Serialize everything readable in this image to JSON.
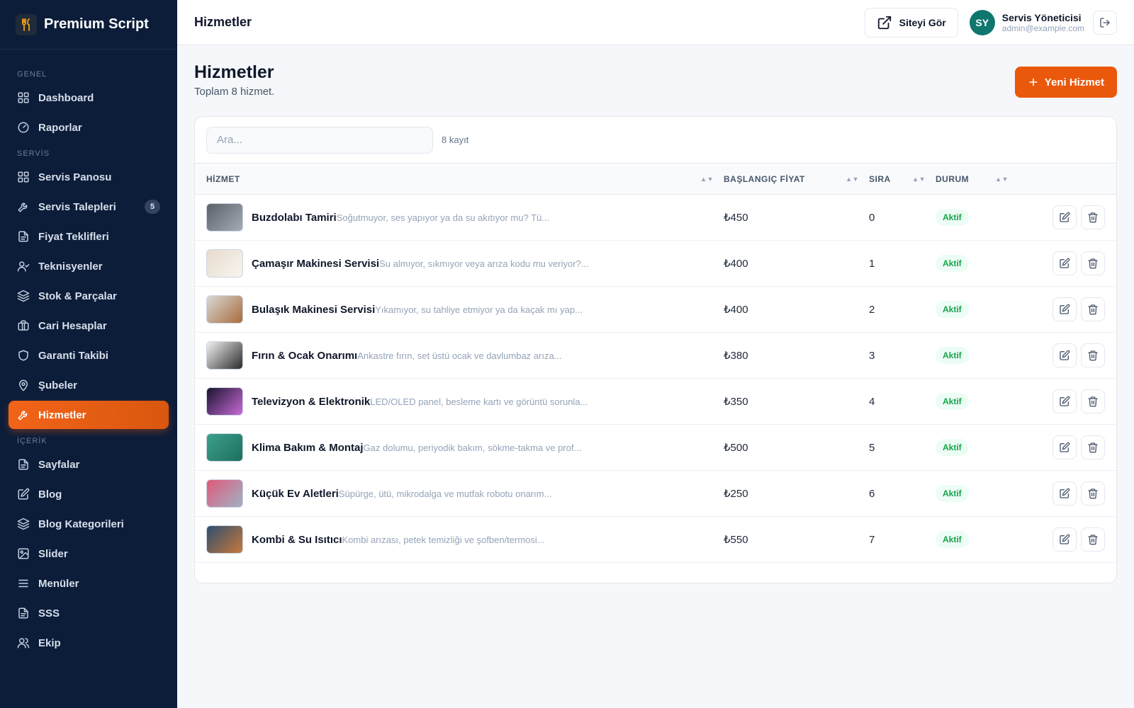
{
  "brand": {
    "title": "Premium Script"
  },
  "sidebar": {
    "sections": [
      {
        "label": "GENEL",
        "items": [
          {
            "label": "Dashboard",
            "icon": "grid-icon"
          },
          {
            "label": "Raporlar",
            "icon": "gauge-icon"
          }
        ]
      },
      {
        "label": "SERVİS",
        "items": [
          {
            "label": "Servis Panosu",
            "icon": "grid-icon"
          },
          {
            "label": "Servis Talepleri",
            "icon": "wrench-icon",
            "badge": "5"
          },
          {
            "label": "Fiyat Teklifleri",
            "icon": "document-icon"
          },
          {
            "label": "Teknisyenler",
            "icon": "user-check-icon"
          },
          {
            "label": "Stok & Parçalar",
            "icon": "layers-icon"
          },
          {
            "label": "Cari Hesaplar",
            "icon": "briefcase-icon"
          },
          {
            "label": "Garanti Takibi",
            "icon": "shield-icon"
          },
          {
            "label": "Şubeler",
            "icon": "map-pin-icon"
          },
          {
            "label": "Hizmetler",
            "icon": "wrench-icon",
            "active": true
          }
        ]
      },
      {
        "label": "İÇERİK",
        "items": [
          {
            "label": "Sayfalar",
            "icon": "document-icon"
          },
          {
            "label": "Blog",
            "icon": "edit-icon"
          },
          {
            "label": "Blog Kategorileri",
            "icon": "layers-icon"
          },
          {
            "label": "Slider",
            "icon": "image-icon"
          },
          {
            "label": "Menüler",
            "icon": "menu-icon"
          },
          {
            "label": "SSS",
            "icon": "document-icon"
          },
          {
            "label": "Ekip",
            "icon": "users-icon"
          }
        ]
      }
    ]
  },
  "topbar": {
    "title": "Hizmetler",
    "site_button": "Siteyi Gör",
    "user_initials": "SY",
    "user_name": "Servis Yöneticisi",
    "user_email": "admin@example.com"
  },
  "page": {
    "title": "Hizmetler",
    "subtitle": "Toplam 8 hizmet.",
    "new_button": "Yeni Hizmet"
  },
  "table": {
    "search_placeholder": "Ara...",
    "count_label": "8 kayıt",
    "columns": [
      "HİZMET",
      "BAŞLANGIÇ FİYAT",
      "SIRA",
      "DURUM"
    ],
    "rows": [
      {
        "name": "Buzdolabı Tamiri",
        "desc": "Soğutmuyor, ses yapıyor ya da su akıtıyor mu? Tü...",
        "price": "₺450",
        "order": "0",
        "status": "Aktif",
        "thumb": [
          "#5b6169",
          "#a5acb5"
        ]
      },
      {
        "name": "Çamaşır Makinesi Servisi",
        "desc": "Su almıyor, sıkmıyor veya arıza kodu mu veriyor?...",
        "price": "₺400",
        "order": "1",
        "status": "Aktif",
        "thumb": [
          "#e7dccd",
          "#f7f4ef"
        ]
      },
      {
        "name": "Bulaşık Makinesi Servisi",
        "desc": "Yıkamıyor, su tahliye etmiyor ya da kaçak mı yap...",
        "price": "₺400",
        "order": "2",
        "status": "Aktif",
        "thumb": [
          "#d8d8d6",
          "#a86b3c"
        ]
      },
      {
        "name": "Fırın & Ocak Onarımı",
        "desc": "Ankastre fırın, set üstü ocak ve davlumbaz arıza...",
        "price": "₺380",
        "order": "3",
        "status": "Aktif",
        "thumb": [
          "#f2f2f2",
          "#2b2b2b"
        ]
      },
      {
        "name": "Televizyon & Elektronik",
        "desc": "LED/OLED panel, besleme kartı ve görüntü sorunla...",
        "price": "₺350",
        "order": "4",
        "status": "Aktif",
        "thumb": [
          "#1a1330",
          "#c86bd6"
        ]
      },
      {
        "name": "Klima Bakım & Montaj",
        "desc": "Gaz dolumu, periyodik bakım, sökme-takma ve prof...",
        "price": "₺500",
        "order": "5",
        "status": "Aktif",
        "thumb": [
          "#3aa08a",
          "#1f6f5e"
        ]
      },
      {
        "name": "Küçük Ev Aletleri",
        "desc": "Süpürge, ütü, mikrodalga ve mutfak robotu onarım...",
        "price": "₺250",
        "order": "6",
        "status": "Aktif",
        "thumb": [
          "#e05a7a",
          "#9fb2c4"
        ]
      },
      {
        "name": "Kombi & Su Isıtıcı",
        "desc": "Kombi arızası, petek temizliği ve şofben/termosi...",
        "price": "₺550",
        "order": "7",
        "status": "Aktif",
        "thumb": [
          "#2f4e6e",
          "#c7783c"
        ]
      }
    ]
  },
  "colors": {
    "sidebar_bg": "#0c1d3a",
    "accent": "#ea580c",
    "status_green": "#16a34a",
    "avatar": "#0f766e"
  }
}
